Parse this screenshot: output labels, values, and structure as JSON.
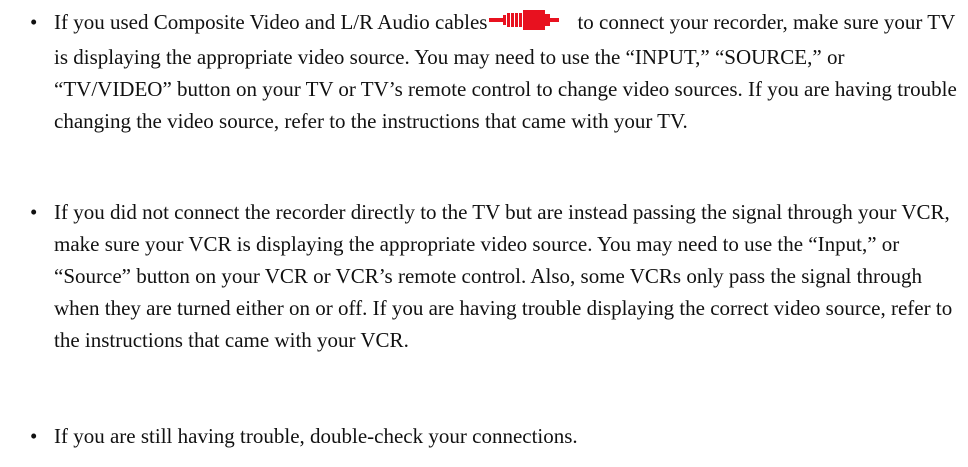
{
  "items": [
    {
      "bullet": "•",
      "text_before_icon": "If you used Composite Video and L/R Audio cables",
      "icon": "rca-cable-icon",
      "icon_color": "#e8111f",
      "text_after_icon": "to connect your recorder, make sure your TV is displaying the appropriate video source. You may need to use the “INPUT,” “SOURCE,” or “TV/VIDEO” button on your TV or TV’s remote control to change video sources. If you are having trouble changing the video source, refer to the instructions that came with your TV."
    },
    {
      "bullet": "•",
      "text": "If you did not connect the recorder directly to the TV but are instead passing the signal through your VCR, make sure your VCR is displaying the appropriate video source. You may need to use the “Input,” or “Source” button on your VCR or VCR’s remote control. Also, some VCRs only pass the signal through when they are turned either on or off. If you are having trouble displaying the correct video source, refer to the instructions that came with your VCR."
    },
    {
      "bullet": "•",
      "text": "If you are still having trouble, double-check your connections."
    }
  ]
}
